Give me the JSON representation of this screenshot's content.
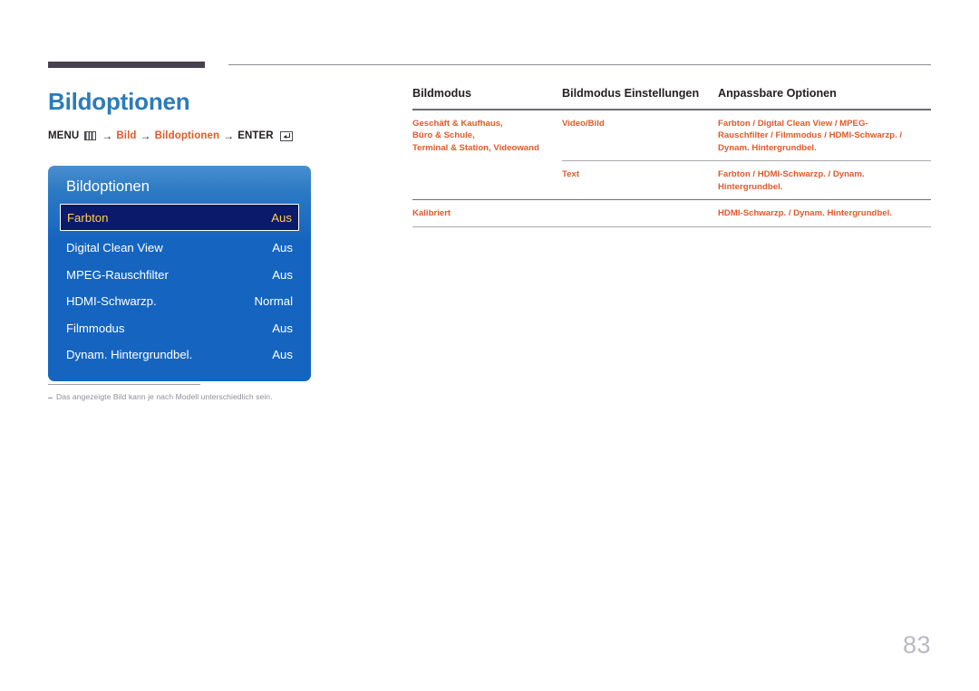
{
  "page": {
    "number": "83"
  },
  "header": {
    "title": "Bildoptionen",
    "breadcrumb": {
      "menu_label": "MENU",
      "menu_icon": "menu-grid-icon",
      "arrow": "→",
      "step1": "Bild",
      "step2": "Bildoptionen",
      "enter_label": "ENTER",
      "enter_icon": "enter-key-icon"
    }
  },
  "osd": {
    "title": "Bildoptionen",
    "rows": [
      {
        "label": "Farbton",
        "value": "Aus",
        "selected": true
      },
      {
        "label": "Digital Clean View",
        "value": "Aus",
        "selected": false
      },
      {
        "label": "MPEG-Rauschfilter",
        "value": "Aus",
        "selected": false
      },
      {
        "label": "HDMI-Schwarzp.",
        "value": "Normal",
        "selected": false
      },
      {
        "label": "Filmmodus",
        "value": "Aus",
        "selected": false
      },
      {
        "label": "Dynam. Hintergrundbel.",
        "value": "Aus",
        "selected": false
      }
    ]
  },
  "footnote": {
    "text": "Das angezeigte Bild kann je nach Modell unterschiedlich sein."
  },
  "table": {
    "headers": [
      "Bildmodus",
      "Bildmodus Einstellungen",
      "Anpassbare Optionen"
    ],
    "rows": [
      {
        "mode": "Geschäft & Kaufhaus,\nBüro & Schule,\nTerminal & Station, Videowand",
        "settings": "Video/Bild",
        "options": "Farbton / Digital Clean View / MPEG-Rauschfilter / Filmmodus / HDMI-Schwarzp. / Dynam. Hintergrundbel."
      },
      {
        "mode": "",
        "settings": "Text",
        "options": "Farbton / HDMI-Schwarzp. / Dynam. Hintergrundbel."
      },
      {
        "mode": "Kalibriert",
        "settings": "",
        "options": "HDMI-Schwarzp. / Dynam. Hintergrundbel."
      }
    ]
  },
  "colors": {
    "title_blue": "#2b7bba",
    "accent_orange": "#e05a2b",
    "osd_blue": "#1565c0",
    "osd_selected_bg": "#0b1a6b",
    "osd_selected_text": "#ffd24d",
    "rule_dark": "#46414e",
    "page_number_gray": "#b9b9c4"
  }
}
